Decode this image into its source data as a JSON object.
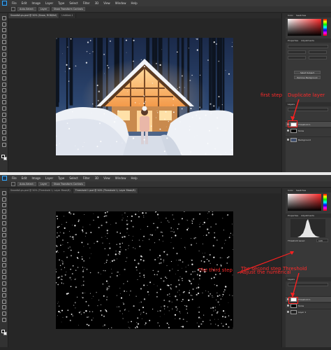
{
  "menu": {
    "items": [
      "File",
      "Edit",
      "Image",
      "Layer",
      "Type",
      "Select",
      "Filter",
      "3D",
      "View",
      "Window",
      "Help"
    ]
  },
  "shot1": {
    "options": [
      "Auto-Select:",
      "Layer",
      "Show Transform Controls"
    ],
    "tabs": [
      "Snowfall-ps.psd @ 50% (Snow, RGB/8#)",
      "Untitled-1"
    ],
    "panel": {
      "tabs": [
        "Color",
        "Swatches"
      ],
      "properties_tabs": [
        "Properties",
        "Adjustments"
      ],
      "layers_tab": "Layers",
      "layers": [
        {
          "name": "Threshold 1",
          "selected": true
        },
        {
          "name": "Snow",
          "selected": false
        },
        {
          "name": "Background",
          "selected": false
        }
      ],
      "buttons": [
        "Select Subject",
        "Remove Background"
      ]
    },
    "annotations": {
      "first_step": "first step",
      "new_layer": "Duplicate layer"
    }
  },
  "shot2": {
    "options": [
      "Auto-Select:",
      "Layer",
      "Show Transform Controls"
    ],
    "tabs": [
      "Snowfall-ps.psd @ 50% (Threshold 1, Layer Mask/8)",
      "Threshold 1 psd @ 50% (Threshold 1, Layer Mask/8)"
    ],
    "panel": {
      "tabs": [
        "Color",
        "Swatches"
      ],
      "properties_tabs": [
        "Properties",
        "Adjustments"
      ],
      "threshold_label": "Threshold Level:",
      "threshold_value": "129",
      "layers_tab": "Layers",
      "layers": [
        {
          "name": "Threshold 1",
          "selected": true
        },
        {
          "name": "Snow",
          "selected": false
        },
        {
          "name": "Layer 1",
          "selected": false
        }
      ]
    },
    "annotations": {
      "third_step": "The third step",
      "adjust": "Adjust the numerical",
      "second_step": "The second step",
      "threshold": "Threshold"
    }
  },
  "colors": {
    "annotation": "#ff2a2a",
    "app_bg": "#282828",
    "panel_bg": "#383838",
    "accent": "#31a8ff"
  },
  "icons": {
    "app_logo": "photoshop-logo-icon",
    "tool": "tool-icon",
    "eye": "eye-icon"
  }
}
